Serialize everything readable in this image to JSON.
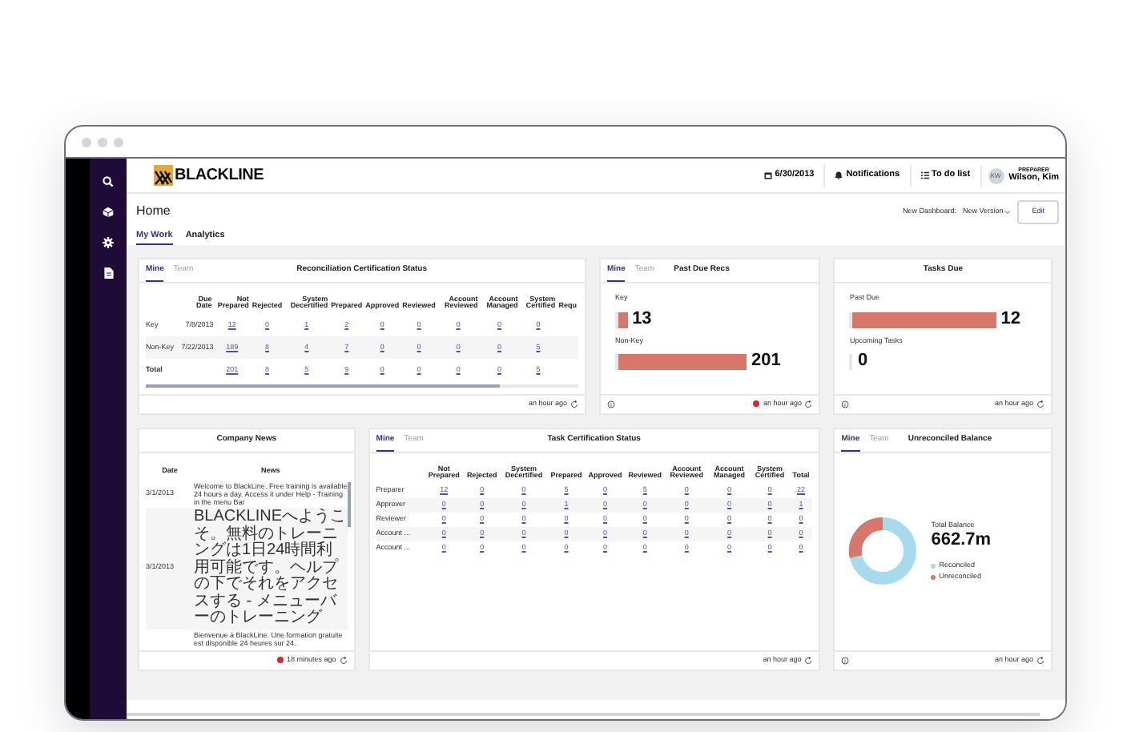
{
  "header": {
    "logo": "BLACKLINE",
    "date": "6/30/2013",
    "notifications": "Notifications",
    "todo": "To do list",
    "user": {
      "initials": "KW",
      "role": "PREPARER",
      "name": "Wilson, Kim"
    }
  },
  "page": {
    "title": "Home",
    "dashboard_label": "New Dashboard:",
    "dashboard_value": "New Version",
    "edit": "Edit",
    "tabs": [
      {
        "label": "My Work",
        "selected": true
      },
      {
        "label": "Analytics",
        "selected": false
      }
    ]
  },
  "recon": {
    "tabs": [
      {
        "label": "Mine",
        "selected": true
      },
      {
        "label": "Team",
        "selected": false
      }
    ],
    "title": "Reconciliation Certification Status",
    "columns": [
      "Due Date",
      "Not Prepared",
      "Rejected",
      "System Decertified",
      "Prepared",
      "Approved",
      "Reviewed",
      "Account Reviewed",
      "Account Managed",
      "System Certified",
      "Requ"
    ],
    "rows": [
      {
        "label": "Key",
        "cells": [
          "7/8/2013",
          "12",
          "0",
          "1",
          "2",
          "0",
          "0",
          "0",
          "0",
          "0"
        ]
      },
      {
        "label": "Non-Key",
        "cells": [
          "7/22/2013",
          "189",
          "8",
          "4",
          "7",
          "0",
          "0",
          "0",
          "0",
          "5"
        ]
      },
      {
        "label": "Total",
        "cells": [
          "",
          "201",
          "8",
          "5",
          "9",
          "0",
          "0",
          "0",
          "0",
          "5"
        ]
      }
    ],
    "footer": "an hour ago"
  },
  "past_due": {
    "tabs": [
      {
        "label": "Mine",
        "selected": true
      },
      {
        "label": "Team",
        "selected": false
      }
    ],
    "title": "Past Due Recs",
    "bars": [
      {
        "label": "Key",
        "value": "13",
        "level": 0.06
      },
      {
        "label": "Non-Key",
        "value": "201",
        "level": 0.86
      }
    ],
    "footer": "an hour ago",
    "alert": true
  },
  "tasks_due": {
    "title": "Tasks Due",
    "bars": [
      {
        "label": "Past Due",
        "value": "12",
        "level": 0.96
      },
      {
        "label": "Upcoming Tasks",
        "value": "0",
        "level": 0
      }
    ],
    "footer": "an hour ago"
  },
  "news": {
    "title": "Company News",
    "columns": [
      "Date",
      "News"
    ],
    "rows": [
      {
        "date": "3/1/2013",
        "text": "Welcome to BlackLine.  Free training is available 24 hours a day.  Access it under Help - Training in the menu Bar"
      },
      {
        "date": "3/1/2013",
        "text": "BLACKLINEへようこそ。無料のトレーニングは1日24時間利用可能です。ヘルプの下でそれをアクセスする - メニューバーのトレーニング"
      },
      {
        "text": "Bienvenue à BlackLine. Une formation gratuite est disponible 24 heures sur 24."
      }
    ],
    "footer": "18 minutes ago",
    "alert": true
  },
  "task_cert": {
    "tabs": [
      {
        "label": "Mine",
        "selected": true
      },
      {
        "label": "Team",
        "selected": false
      }
    ],
    "title": "Task Certification Status",
    "columns": [
      "Not Prepared",
      "Rejected",
      "System Decertified",
      "Prepared",
      "Approved",
      "Reviewed",
      "Account Reviewed",
      "Account Managed",
      "System Certified",
      "Total"
    ],
    "rows": [
      {
        "label": "Preparer",
        "cells": [
          "12",
          "0",
          "0",
          "5",
          "0",
          "5",
          "0",
          "0",
          "0",
          "22"
        ]
      },
      {
        "label": "Approver",
        "cells": [
          "0",
          "0",
          "0",
          "1",
          "0",
          "0",
          "0",
          "0",
          "0",
          "1"
        ]
      },
      {
        "label": "Reviewer",
        "cells": [
          "0",
          "0",
          "0",
          "0",
          "0",
          "0",
          "0",
          "0",
          "0",
          "0"
        ]
      },
      {
        "label": "Account ...",
        "cells": [
          "0",
          "0",
          "0",
          "0",
          "0",
          "0",
          "0",
          "0",
          "0",
          "0"
        ]
      },
      {
        "label": "Account ...",
        "cells": [
          "0",
          "0",
          "0",
          "0",
          "0",
          "0",
          "0",
          "0",
          "0",
          "0"
        ]
      }
    ],
    "footer": "an hour ago"
  },
  "balance": {
    "tabs": [
      {
        "label": "Mine",
        "selected": true
      },
      {
        "label": "Team",
        "selected": false
      }
    ],
    "title": "Unreconciled Balance",
    "total_label": "Total Balance",
    "total": "662.7m",
    "legend": [
      {
        "label": "Reconciled",
        "color": "#a8daee"
      },
      {
        "label": "Unreconciled",
        "color": "#d6776a"
      }
    ],
    "footer": "an hour ago"
  }
}
